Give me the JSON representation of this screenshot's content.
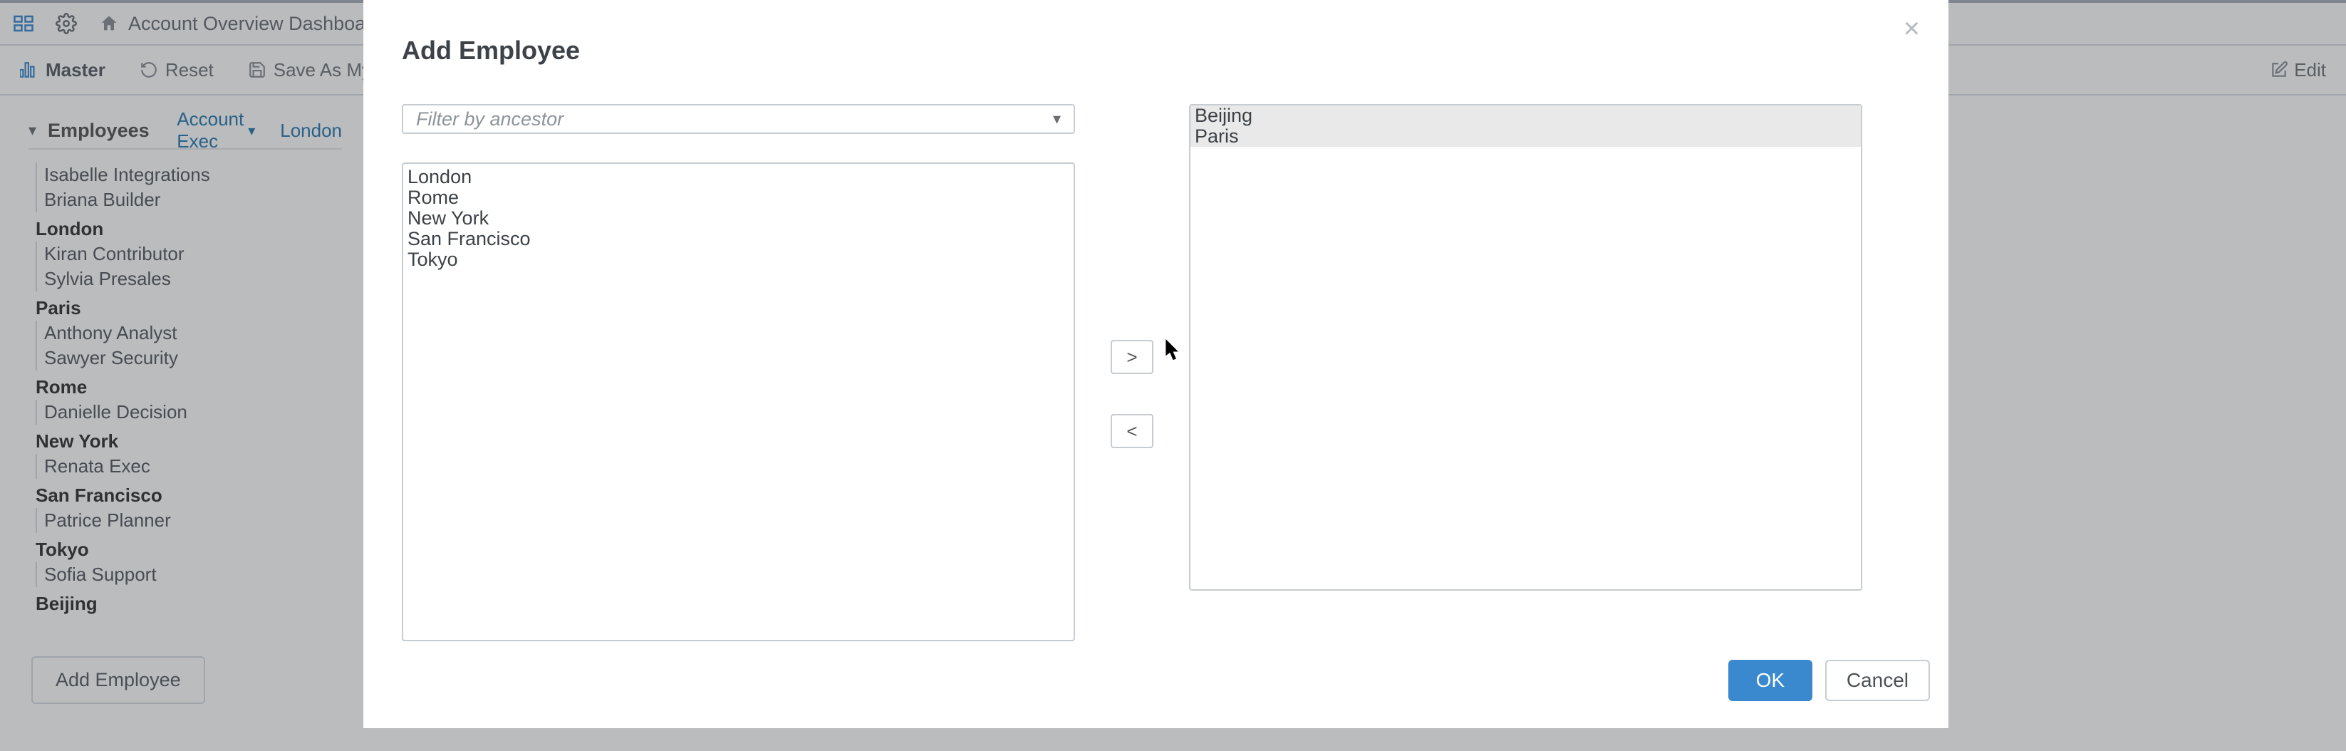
{
  "top": {
    "title": "Account Overview Dashboard"
  },
  "toolbar": {
    "master": "Master",
    "reset": "Reset",
    "saveAsMy": "Save As My View",
    "edit": "Edit"
  },
  "sidebar": {
    "title": "Employees",
    "dimension": "Account Exec",
    "filter": "London",
    "groups": [
      {
        "name": "",
        "items": [
          "Isabelle Integrations",
          "Briana Builder"
        ]
      },
      {
        "name": "London",
        "items": [
          "Kiran Contributor",
          "Sylvia Presales"
        ]
      },
      {
        "name": "Paris",
        "items": [
          "Anthony Analyst",
          "Sawyer Security"
        ]
      },
      {
        "name": "Rome",
        "items": [
          "Danielle Decision"
        ]
      },
      {
        "name": "New York",
        "items": [
          "Renata Exec"
        ]
      },
      {
        "name": "San Francisco",
        "items": [
          "Patrice Planner"
        ]
      },
      {
        "name": "Tokyo",
        "items": [
          "Sofia Support"
        ]
      },
      {
        "name": "Beijing",
        "items": []
      }
    ],
    "addButton": "Add Employee"
  },
  "dialog": {
    "title": "Add Employee",
    "filterPlaceholder": "Filter by ancestor",
    "available": [
      "London",
      "Rome",
      "New York",
      "San Francisco",
      "Tokyo"
    ],
    "selected": [
      "Beijing",
      "Paris"
    ],
    "ok": "OK",
    "cancel": "Cancel",
    "add_label": ">",
    "remove_label": "<",
    "close_label": "×"
  },
  "colors": {
    "accent": "#3a89cf",
    "link": "#2a7ab0",
    "border": "#c7ccd1"
  }
}
